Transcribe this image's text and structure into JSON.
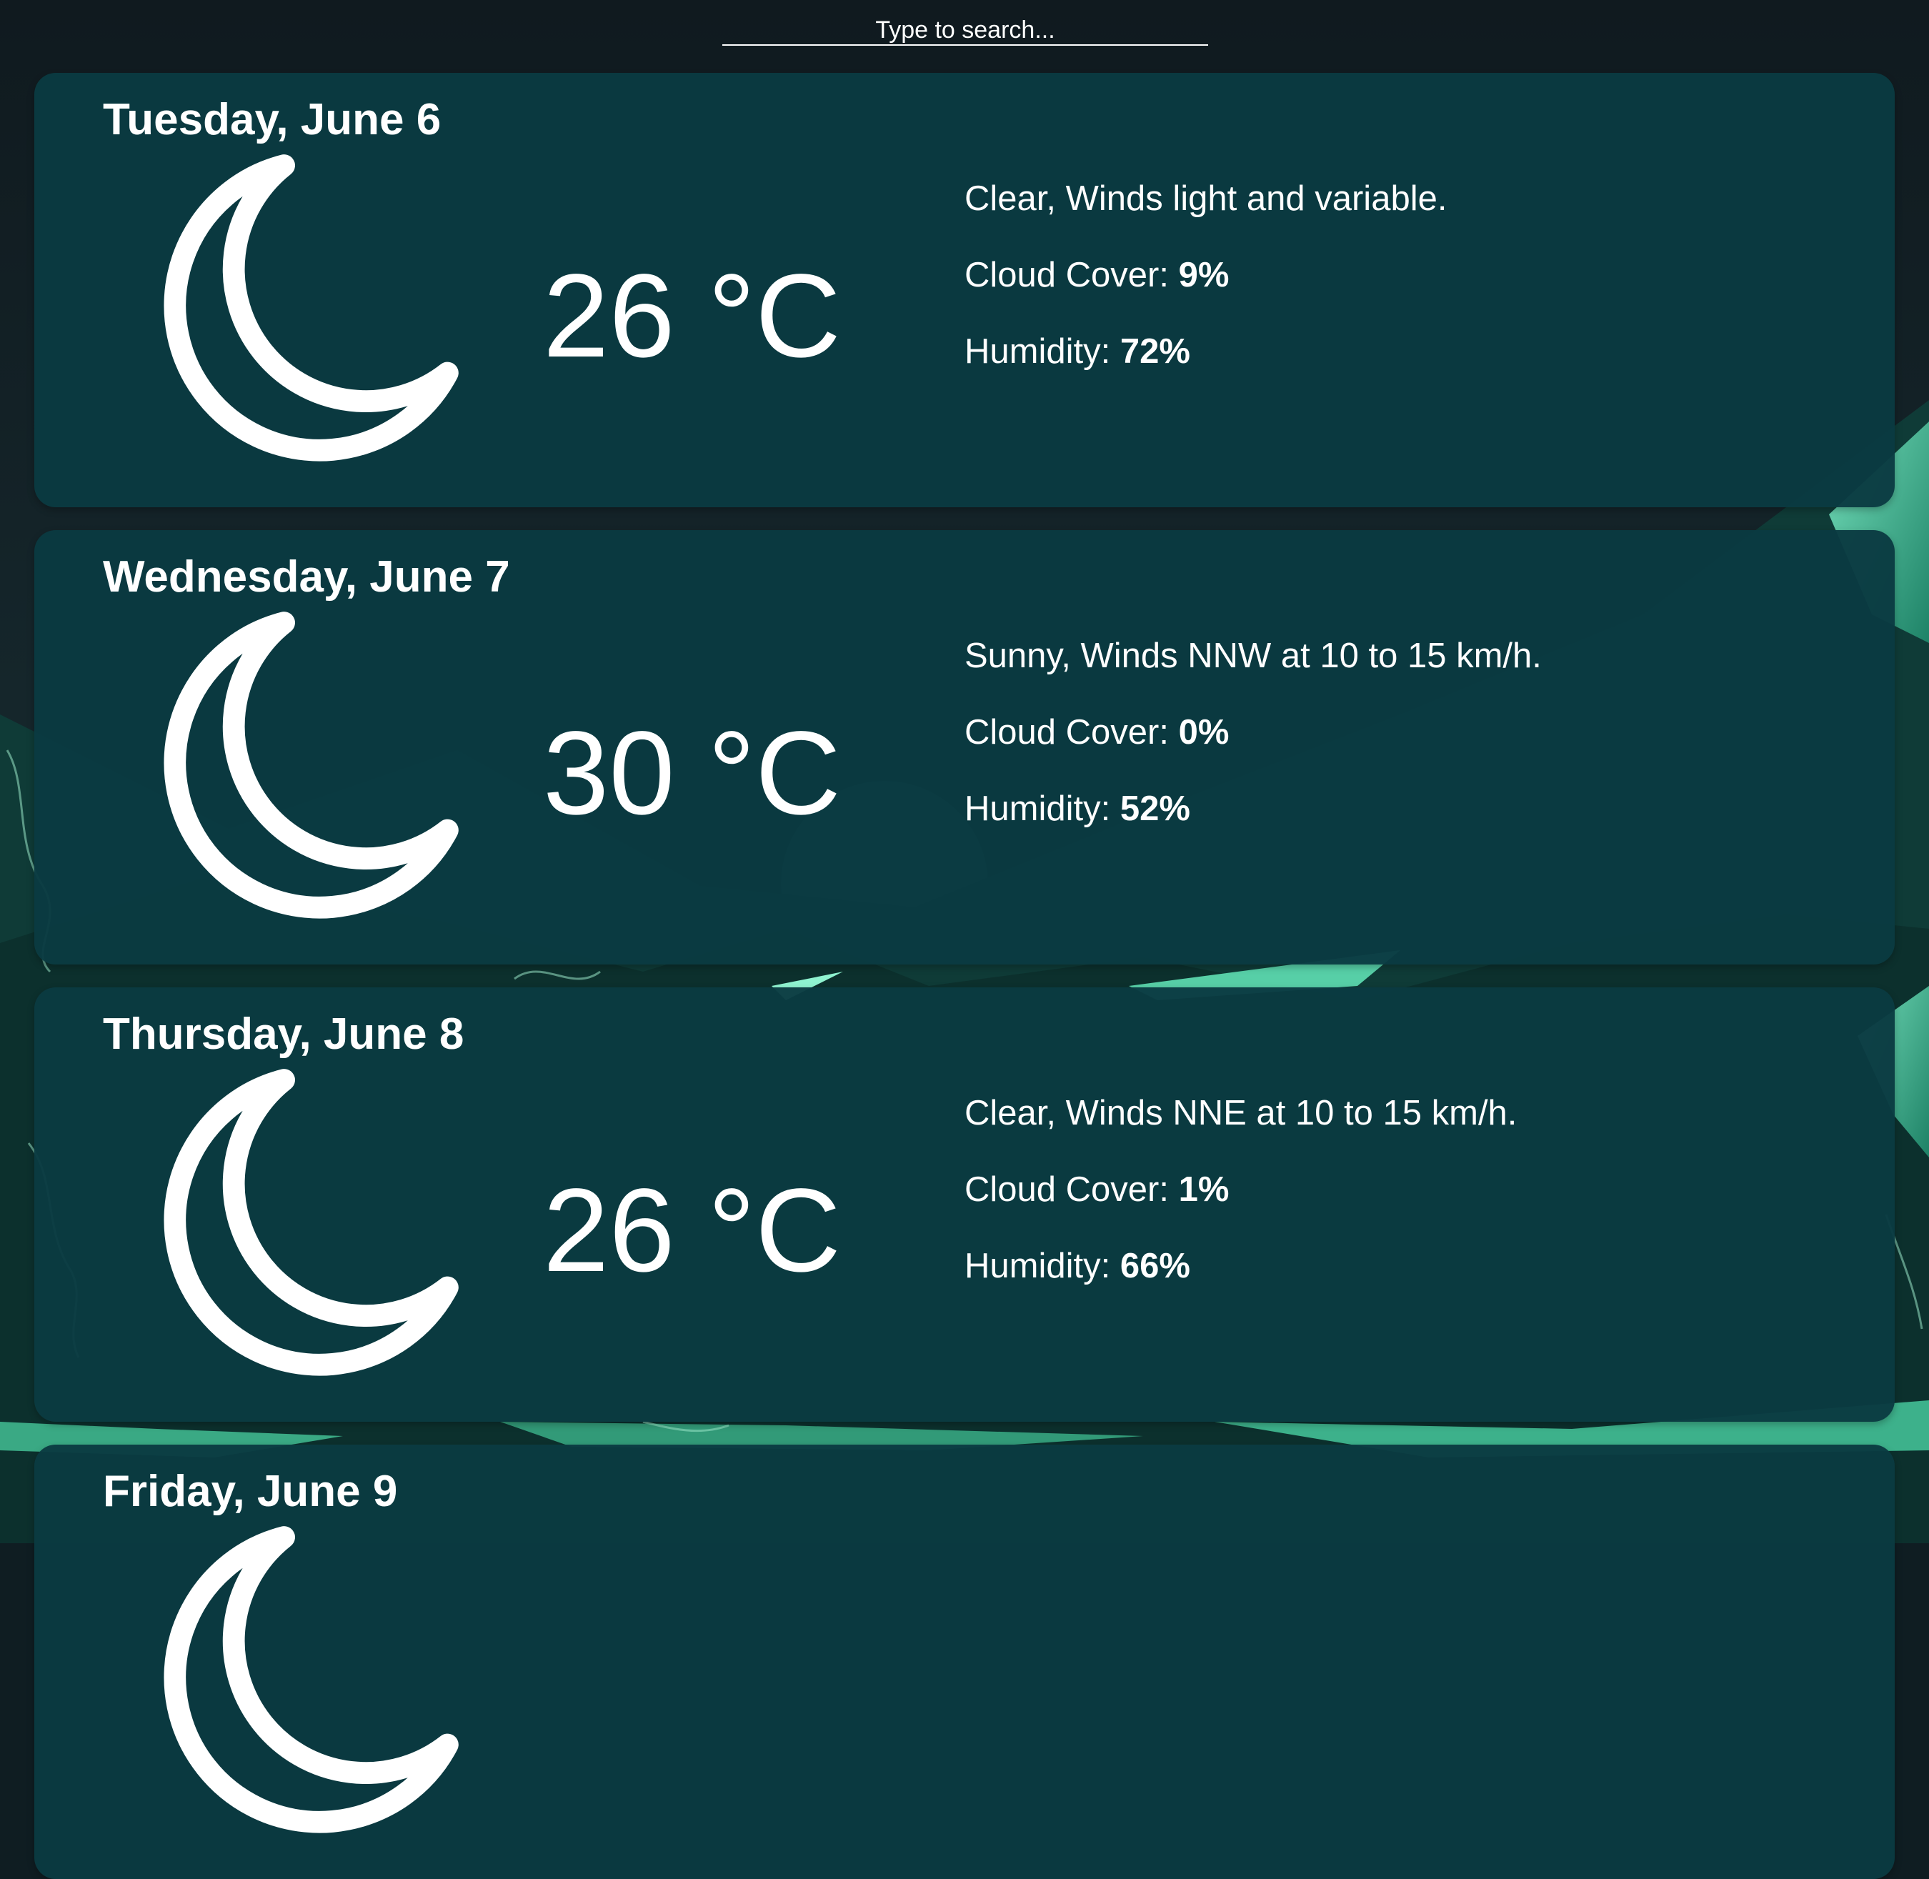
{
  "search": {
    "placeholder": "Type to search..."
  },
  "unit": "°C",
  "labels": {
    "cloud_cover": "Cloud Cover:",
    "humidity": "Humidity:"
  },
  "days": [
    {
      "title": "Tuesday, June 6",
      "icon": "moon-icon",
      "temp": "26 °C",
      "summary": "Clear, Winds light and variable.",
      "cloud_cover": "9%",
      "humidity": "72%"
    },
    {
      "title": "Wednesday, June 7",
      "icon": "moon-icon",
      "temp": "30 °C",
      "summary": "Sunny, Winds NNW at 10 to 15 km/h.",
      "cloud_cover": "0%",
      "humidity": "52%"
    },
    {
      "title": "Thursday, June 8",
      "icon": "moon-icon",
      "temp": "26 °C",
      "summary": "Clear, Winds NNE at 10 to 15 km/h.",
      "cloud_cover": "1%",
      "humidity": "66%"
    },
    {
      "title": "Friday, June 9",
      "icon": "moon-icon"
    }
  ],
  "colors": {
    "card": "#0a3a42",
    "text": "#ffffff",
    "accent": "#45d6a8",
    "page": "#0f1d22"
  }
}
